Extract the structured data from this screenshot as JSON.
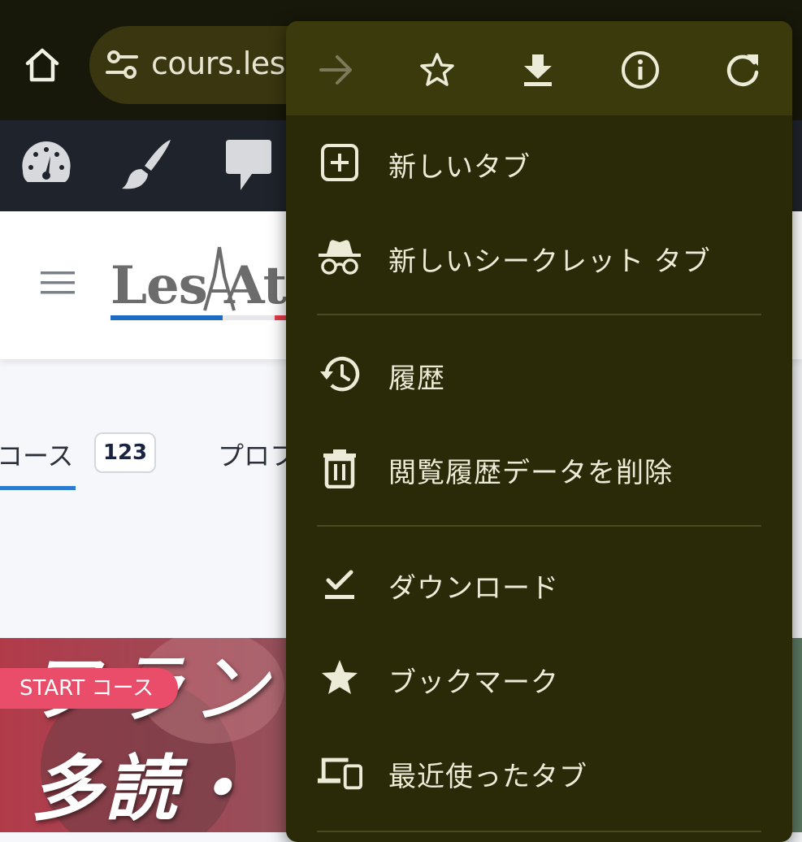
{
  "browser": {
    "url_display": "cours.les",
    "home_icon": "home-icon",
    "site_settings_icon": "tune-icon"
  },
  "site": {
    "logo_text": "Les Ate",
    "tabs": [
      {
        "label": "コース",
        "count": "123",
        "active": true
      },
      {
        "label": "プロフ",
        "active": false
      }
    ],
    "card": {
      "badge": "START コース",
      "title_line1": "フラン",
      "title_line2": "多読・"
    }
  },
  "menu": {
    "toolbar": [
      "forward-icon",
      "bookmark-star-icon",
      "download-icon",
      "info-icon",
      "reload-icon"
    ],
    "items": [
      {
        "label": "新しいタブ",
        "icon": "new-tab-icon"
      },
      {
        "label": "新しいシークレット タブ",
        "icon": "incognito-icon"
      },
      {
        "label": "履歴",
        "icon": "history-icon"
      },
      {
        "label": "閲覧履歴データを削除",
        "icon": "trash-icon"
      },
      {
        "label": "ダウンロード",
        "icon": "downloads-icon"
      },
      {
        "label": "ブックマーク",
        "icon": "star-icon"
      },
      {
        "label": "最近使ったタブ",
        "icon": "devices-icon"
      }
    ]
  },
  "colors": {
    "menu_bg": "#2a2a08",
    "menu_toolbar_bg": "#3b3a0c",
    "menu_text": "#ecebd8",
    "admin_bar": "#1f232b",
    "accent_blue": "#2b7bd0",
    "badge_pink": "#ea4d6a"
  }
}
